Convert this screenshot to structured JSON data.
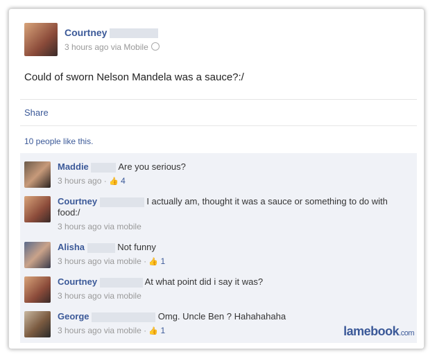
{
  "post": {
    "author": "Courtney",
    "meta": "3 hours ago via Mobile",
    "text": "Could of sworn Nelson Mandela was a sauce?:/",
    "share_label": "Share",
    "likes_text": "10 people like this."
  },
  "comments": [
    {
      "name": "Maddie",
      "text": "Are you serious?",
      "meta": "3 hours ago",
      "likes": "4"
    },
    {
      "name": "Courtney",
      "text": "I actually am, thought it was a sauce or something to do with food:/",
      "meta": "3 hours ago via mobile",
      "likes": ""
    },
    {
      "name": "Alisha",
      "text": "Not funny",
      "meta": "3 hours ago via mobile",
      "likes": "1"
    },
    {
      "name": "Courtney",
      "text": "At what point did i say it was?",
      "meta": "3 hours ago via mobile",
      "likes": ""
    },
    {
      "name": "George",
      "text": "Omg. Uncle Ben ? Hahahahaha",
      "meta": "3 hours ago via mobile",
      "likes": "1"
    }
  ],
  "watermark": {
    "main": "lamebook",
    "suffix": ".com"
  },
  "icons": {
    "globe": "globe-icon",
    "like": "thumbs-up-icon"
  },
  "colors": {
    "link": "#3b5998",
    "meta": "#999999",
    "comment_bg": "#f0f2f7"
  }
}
